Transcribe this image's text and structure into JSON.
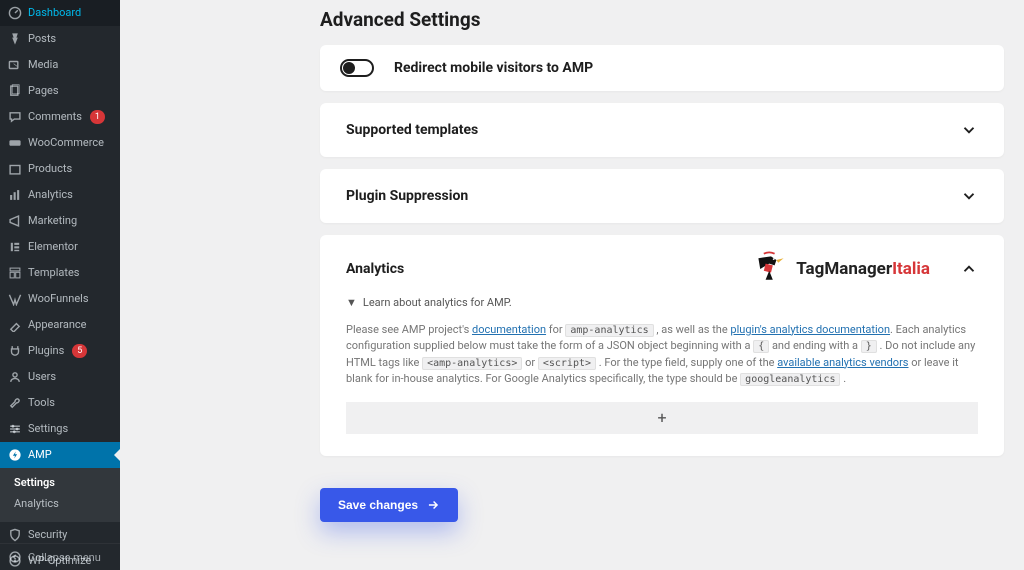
{
  "sidebar": {
    "items": [
      {
        "label": "Dashboard",
        "icon": "dashboard"
      },
      {
        "label": "Posts",
        "icon": "pin"
      },
      {
        "label": "Media",
        "icon": "media"
      },
      {
        "label": "Pages",
        "icon": "pages"
      },
      {
        "label": "Comments",
        "icon": "comments",
        "badge": "1"
      },
      {
        "label": "WooCommerce",
        "icon": "woo"
      },
      {
        "label": "Products",
        "icon": "products"
      },
      {
        "label": "Analytics",
        "icon": "analytics"
      },
      {
        "label": "Marketing",
        "icon": "marketing"
      },
      {
        "label": "Elementor",
        "icon": "elementor"
      },
      {
        "label": "Templates",
        "icon": "templates"
      },
      {
        "label": "WooFunnels",
        "icon": "woofunnels"
      },
      {
        "label": "Appearance",
        "icon": "appearance"
      },
      {
        "label": "Plugins",
        "icon": "plugins",
        "badge": "5"
      },
      {
        "label": "Users",
        "icon": "users"
      },
      {
        "label": "Tools",
        "icon": "tools"
      },
      {
        "label": "Settings",
        "icon": "settings"
      },
      {
        "label": "AMP",
        "icon": "amp",
        "active": true
      },
      {
        "label": "Security",
        "icon": "security"
      },
      {
        "label": "WP-Optimize",
        "icon": "optimize"
      }
    ],
    "sub": {
      "items": [
        {
          "label": "Settings",
          "current": true
        },
        {
          "label": "Analytics",
          "current": false
        }
      ]
    },
    "collapse_label": "Collapse menu"
  },
  "page": {
    "title": "Advanced Settings",
    "redirect_title": "Redirect mobile visitors to AMP",
    "supported_templates_title": "Supported templates",
    "plugin_suppression_title": "Plugin Suppression",
    "analytics_title": "Analytics",
    "learn_label": "Learn about analytics for AMP.",
    "help_text": {
      "part1": "Please see AMP project's ",
      "link1": "documentation",
      "part2": " for ",
      "code1": "amp-analytics",
      "part3": " , as well as the ",
      "link2": "plugin's analytics documentation",
      "part4": ". Each analytics configuration supplied below must take the form of a JSON object beginning with a ",
      "code2": "{",
      "part5": " and ending with a ",
      "code3": "}",
      "part6": " . Do not include any HTML tags like ",
      "code4": "<amp-analytics>",
      "part7": " or ",
      "code5": "<script>",
      "part8": " . For the type field, supply one of the ",
      "link3": "available analytics vendors",
      "part9": " or leave it blank for in-house analytics. For Google Analytics specifically, the type should be ",
      "code6": "googleanalytics",
      "part10": " ."
    },
    "add_button": "+",
    "save_button": "Save changes",
    "logo": {
      "brand1": "TagManager",
      "brand2": "Italia"
    }
  }
}
